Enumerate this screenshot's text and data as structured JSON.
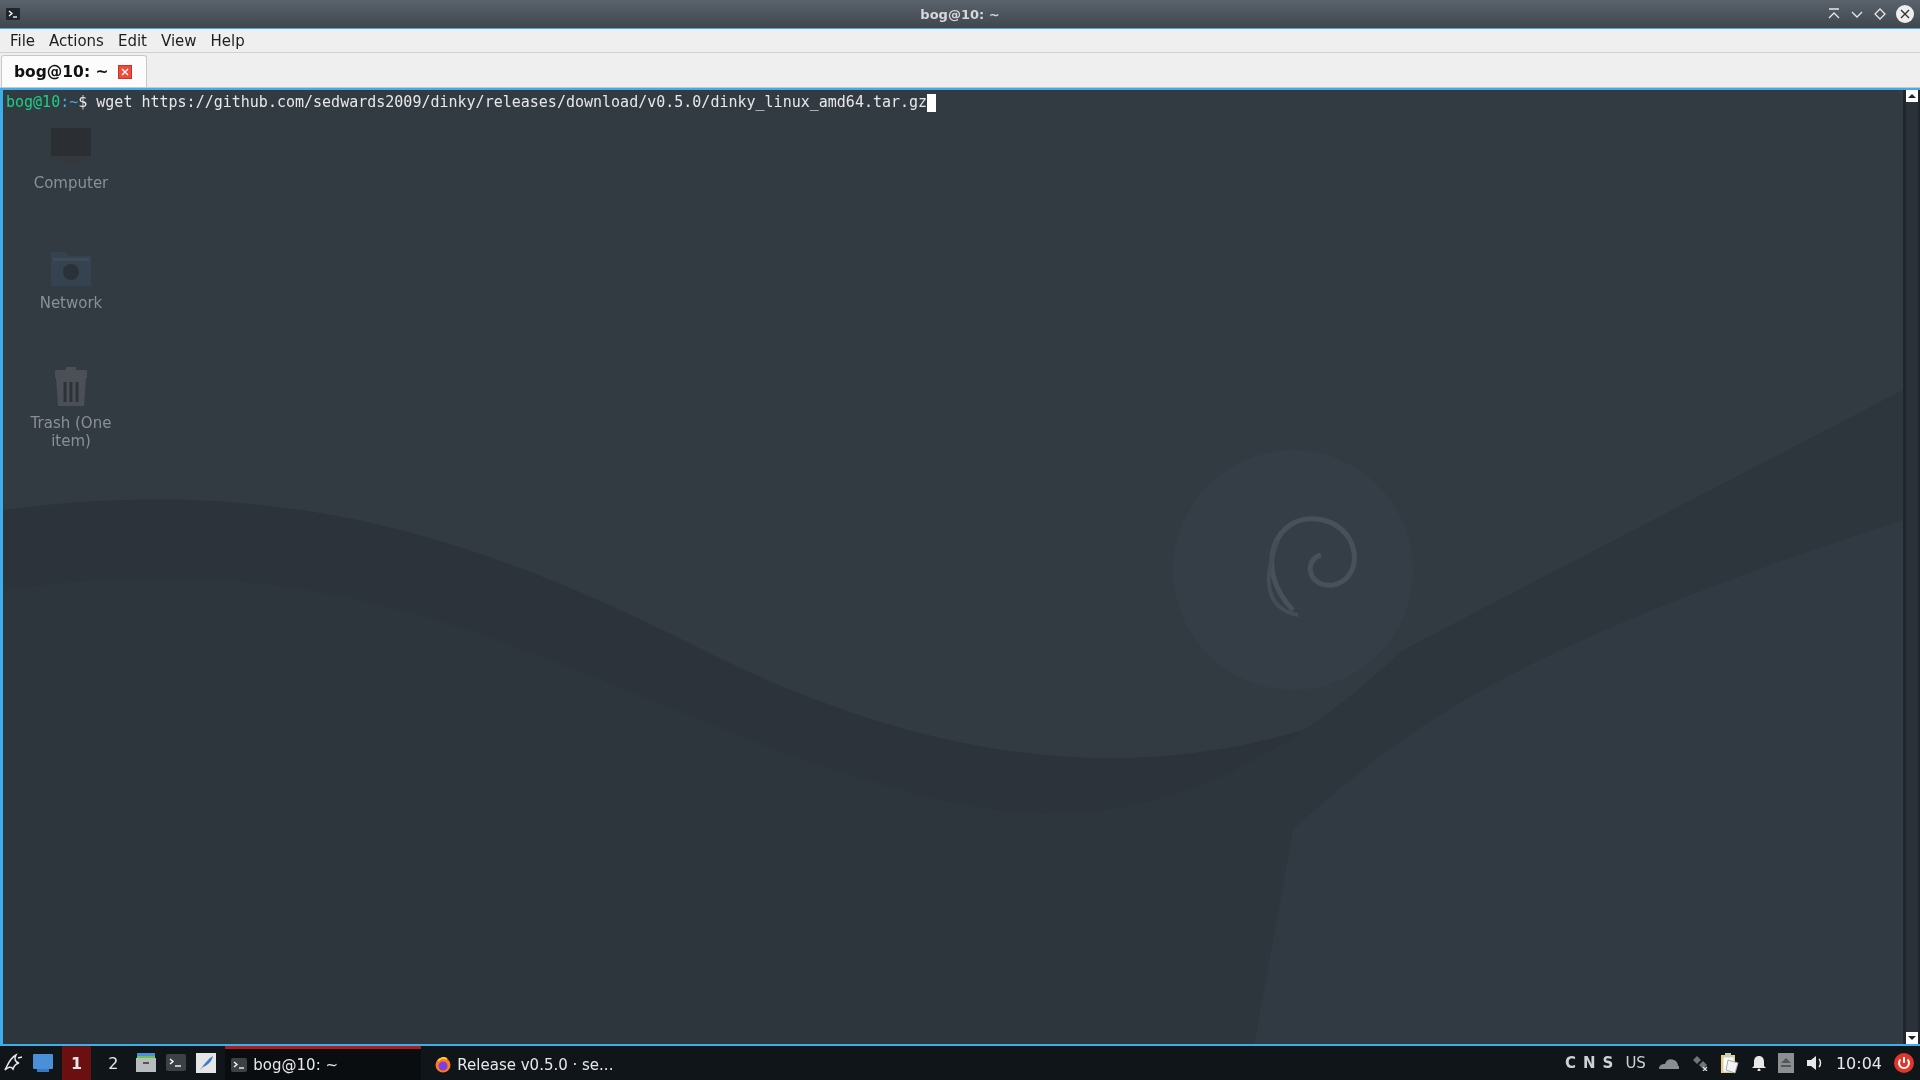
{
  "window": {
    "title": "bog@10: ~"
  },
  "menu": [
    "File",
    "Actions",
    "Edit",
    "View",
    "Help"
  ],
  "tabs": [
    {
      "label": "bog@10: ~",
      "selected": true
    }
  ],
  "terminal": {
    "prompt_user": "bog@10",
    "prompt_path": ":~",
    "prompt_symbol": "$",
    "command": "wget https://github.com/sedwards2009/dinky/releases/download/v0.5.0/dinky_linux_amd64.tar.gz"
  },
  "desktop_icons": [
    {
      "label": "Computer",
      "kind": "computer"
    },
    {
      "label": "Network",
      "kind": "network"
    },
    {
      "label": "Trash (One item)",
      "kind": "trash"
    }
  ],
  "taskbar": {
    "workspaces": [
      {
        "label": "1",
        "selected": true
      },
      {
        "label": "2",
        "selected": false
      }
    ],
    "launchers": [
      {
        "kind": "files"
      },
      {
        "kind": "terminal"
      },
      {
        "kind": "editor"
      }
    ],
    "tasks": [
      {
        "label": "bog@10: ~",
        "kind": "terminal",
        "selected": true
      },
      {
        "label": "Release v0.5.0 · se...",
        "kind": "browser",
        "selected": false
      }
    ],
    "indicators": [
      "C",
      "N",
      "S"
    ],
    "keyboard_layout": "US",
    "clock": "10:04"
  }
}
